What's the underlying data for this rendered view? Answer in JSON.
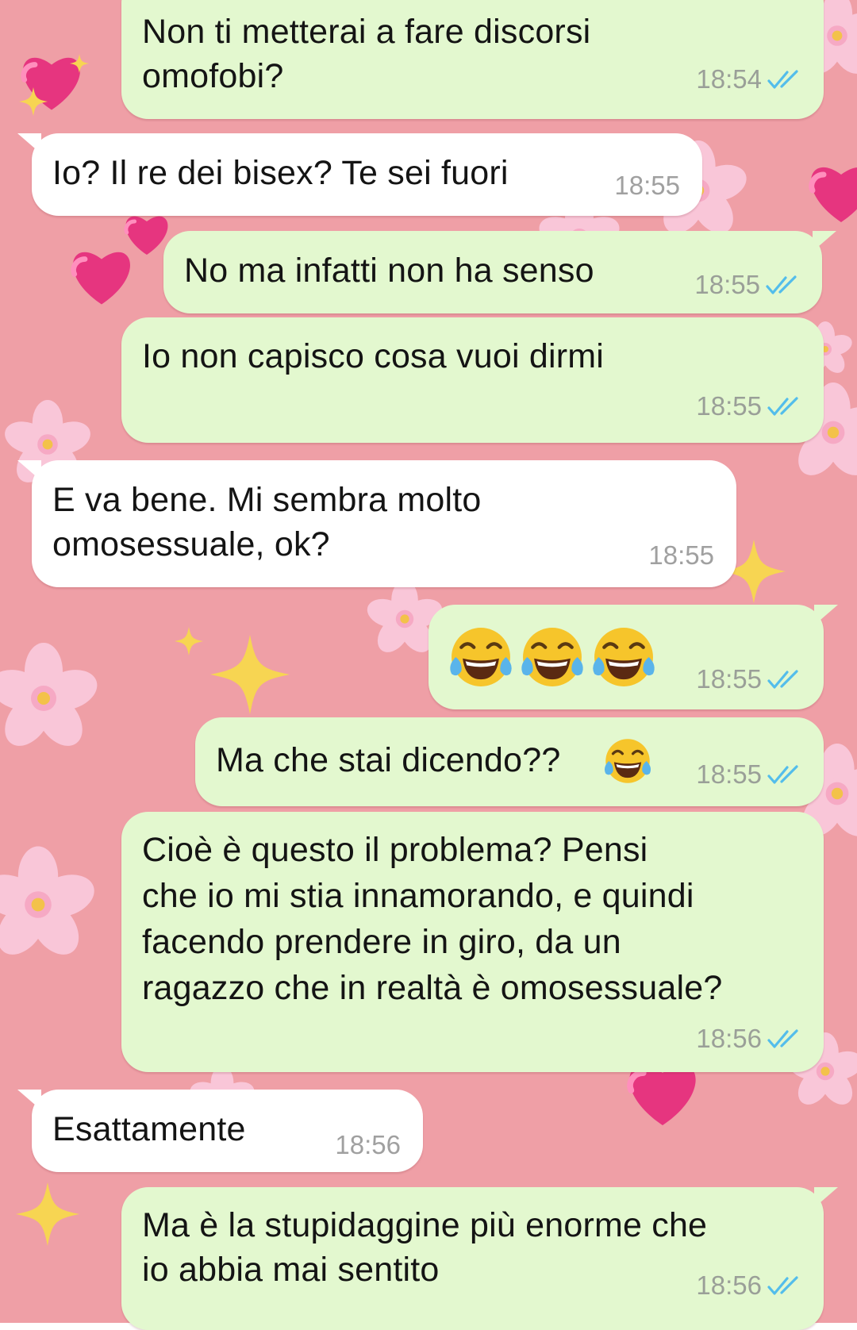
{
  "chat": {
    "background_color": "#ef9fa6",
    "outgoing_bubble_color": "#e3f8cf",
    "incoming_bubble_color": "#ffffff",
    "read_tick_color": "#53bdeb",
    "messages": [
      {
        "direction": "out",
        "lines": [
          "Non ti metterai a fare discorsi",
          "omofobi?"
        ],
        "time": "18:54",
        "status": "read"
      },
      {
        "direction": "in",
        "lines": [
          "Io? Il re dei bisex? Te sei fuori"
        ],
        "time": "18:55"
      },
      {
        "direction": "out",
        "lines": [
          "No ma infatti non ha senso"
        ],
        "time": "18:55",
        "status": "read"
      },
      {
        "direction": "out",
        "lines": [
          "Io non capisco cosa vuoi dirmi"
        ],
        "time": "18:55",
        "status": "read"
      },
      {
        "direction": "in",
        "lines": [
          "E va bene. Mi sembra molto",
          "omosessuale, ok?"
        ],
        "time": "18:55"
      },
      {
        "direction": "out",
        "lines": [],
        "emojis": [
          "tears-of-joy-icon",
          "tears-of-joy-icon",
          "tears-of-joy-icon"
        ],
        "time": "18:55",
        "status": "read"
      },
      {
        "direction": "out",
        "lines": [
          "Ma che stai dicendo??"
        ],
        "emojis": [
          "tears-of-joy-icon"
        ],
        "time": "18:55",
        "status": "read"
      },
      {
        "direction": "out",
        "lines": [
          "Cioè è questo il problema? Pensi",
          "che io mi stia innamorando, e quindi",
          "facendo prendere in giro, da un",
          "ragazzo che in realtà è omosessuale?"
        ],
        "time": "18:56",
        "status": "read"
      },
      {
        "direction": "in",
        "lines": [
          "Esattamente"
        ],
        "time": "18:56"
      },
      {
        "direction": "out",
        "lines": [
          "Ma è la stupidaggine più enorme che",
          "io abbia mai sentito"
        ],
        "time": "18:56",
        "status": "read"
      }
    ]
  }
}
